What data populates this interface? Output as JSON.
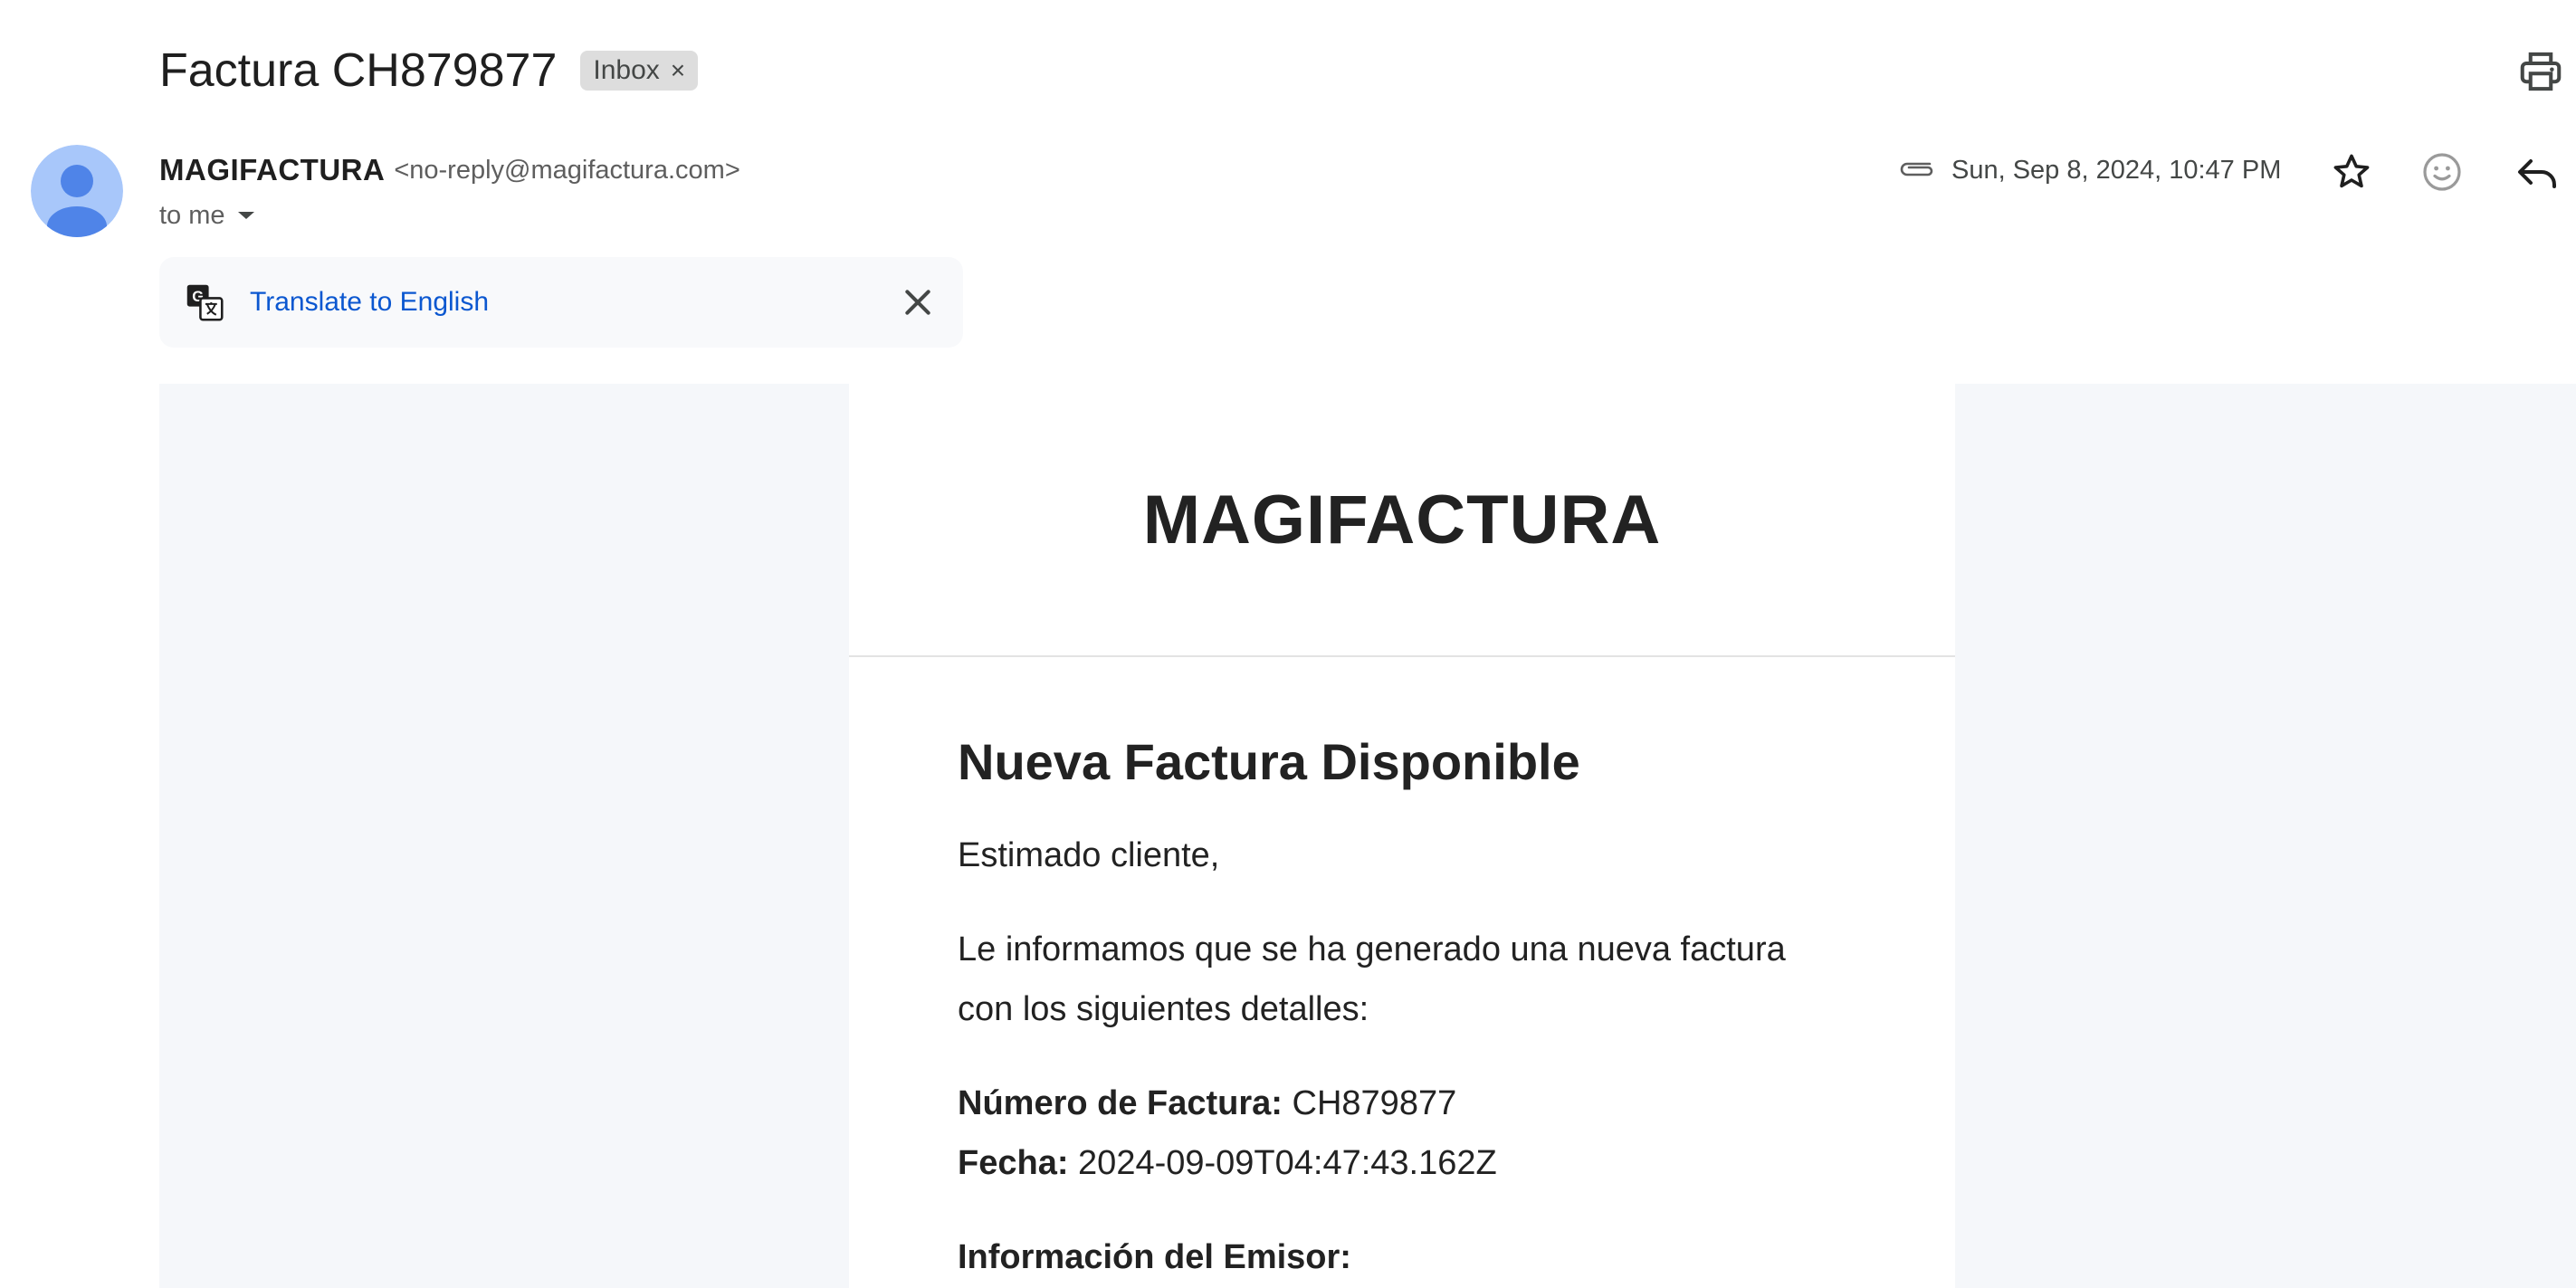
{
  "subject": "Factura CH879877",
  "label_chip": {
    "text": "Inbox",
    "remove": "×"
  },
  "sender": {
    "name": "MAGIFACTURA",
    "email": "<no-reply@magifactura.com>",
    "to": "to me"
  },
  "date": "Sun, Sep 8, 2024, 10:47 PM",
  "translate": {
    "link": "Translate to English"
  },
  "icons": {
    "print": "print-icon",
    "attachment": "paperclip-icon",
    "star": "star-icon",
    "emoji": "emoji-icon",
    "reply": "reply-icon",
    "translate": "translate-icon",
    "close": "close-icon",
    "avatar": "avatar"
  },
  "colors": {
    "link": "#0b57d0",
    "avatar_bg": "#a8c7fa",
    "avatar_fg": "#4f84e8",
    "email_background": "#f5f7fa"
  },
  "email": {
    "brand": "MAGIFACTURA",
    "title": "Nueva Factura Disponible",
    "greeting": "Estimado cliente,",
    "intro": "Le informamos que se ha generado una nueva factura con los siguientes detalles:",
    "invoice_number_label": "Número de Factura:",
    "invoice_number": "CH879877",
    "date_label": "Fecha:",
    "date_value": "2024-09-09T04:47:43.162Z",
    "issuer_heading": "Información del Emisor:"
  }
}
